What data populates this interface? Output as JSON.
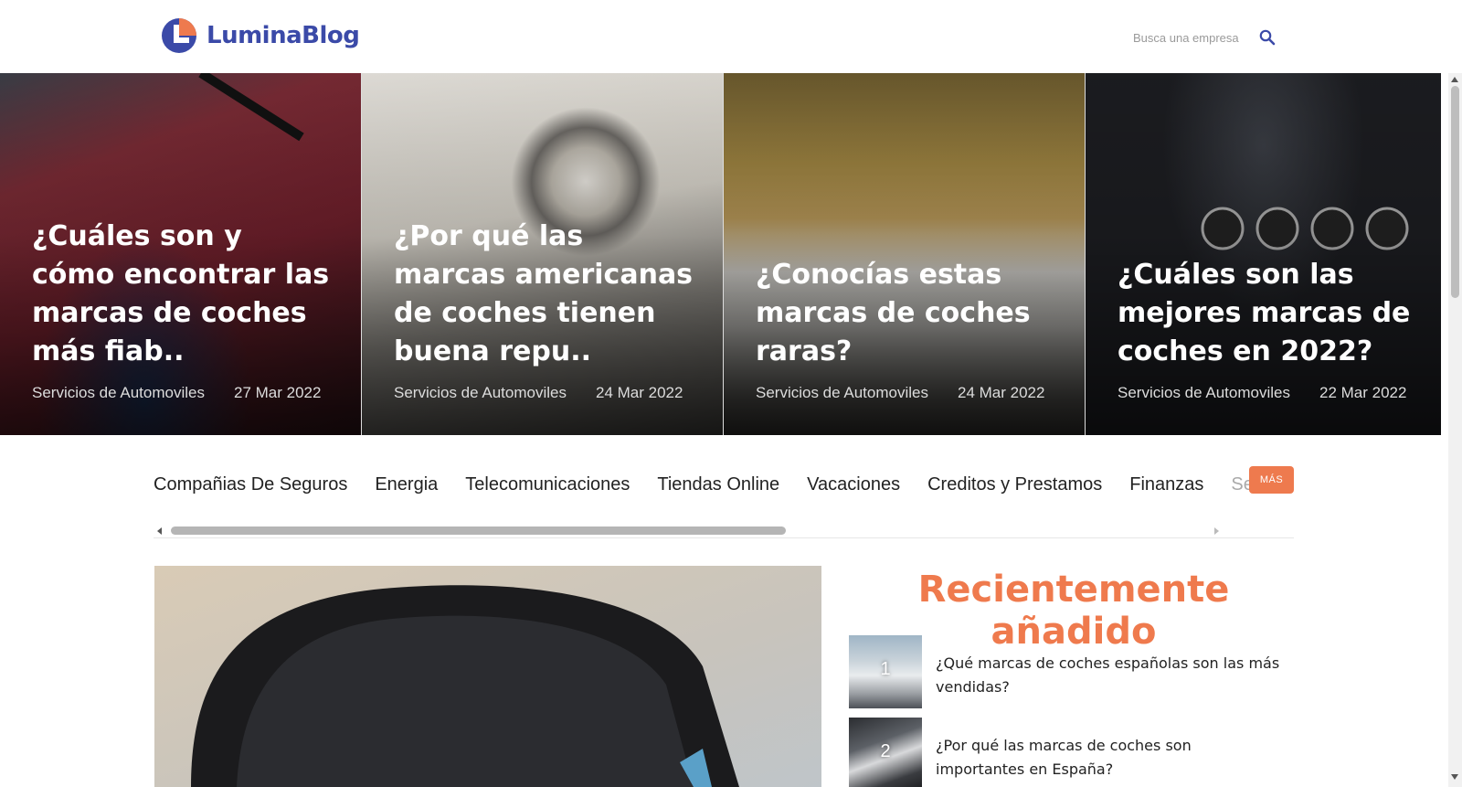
{
  "header": {
    "logo_text": "LuminaBlog",
    "search_placeholder": "Busca una empresa",
    "search_icon": "search-icon"
  },
  "hero": [
    {
      "title": "¿Cuáles son y cómo encontrar las marcas de coches más fiab..",
      "category": "Servicios de Automoviles",
      "date": "27 Mar 2022"
    },
    {
      "title": "¿Por qué las marcas americanas de coches tienen buena repu..",
      "category": "Servicios de Automoviles",
      "date": "24 Mar 2022"
    },
    {
      "title": "¿Conocías estas marcas de coches raras?",
      "category": "Servicios de Automoviles",
      "date": "24 Mar 2022"
    },
    {
      "title": "¿Cuáles son las mejores marcas de coches en 2022?",
      "category": "Servicios de Automoviles",
      "date": "22 Mar 2022"
    }
  ],
  "categories": {
    "items": [
      "Compañias De Seguros",
      "Energia",
      "Telecomunicaciones",
      "Tiendas Online",
      "Vacaciones",
      "Creditos y Prestamos",
      "Finanzas"
    ],
    "faded_item": "Servicios",
    "more_label": "MÁS"
  },
  "recent": {
    "title": "Recientemente añadido",
    "items": [
      {
        "num": "1",
        "text": "¿Qué marcas de coches españolas son las más vendidas?"
      },
      {
        "num": "2",
        "text": "¿Por qué las marcas de coches son importantes en España?"
      }
    ]
  },
  "colors": {
    "brand": "#3b4aa8",
    "accent": "#ee7a4e"
  }
}
